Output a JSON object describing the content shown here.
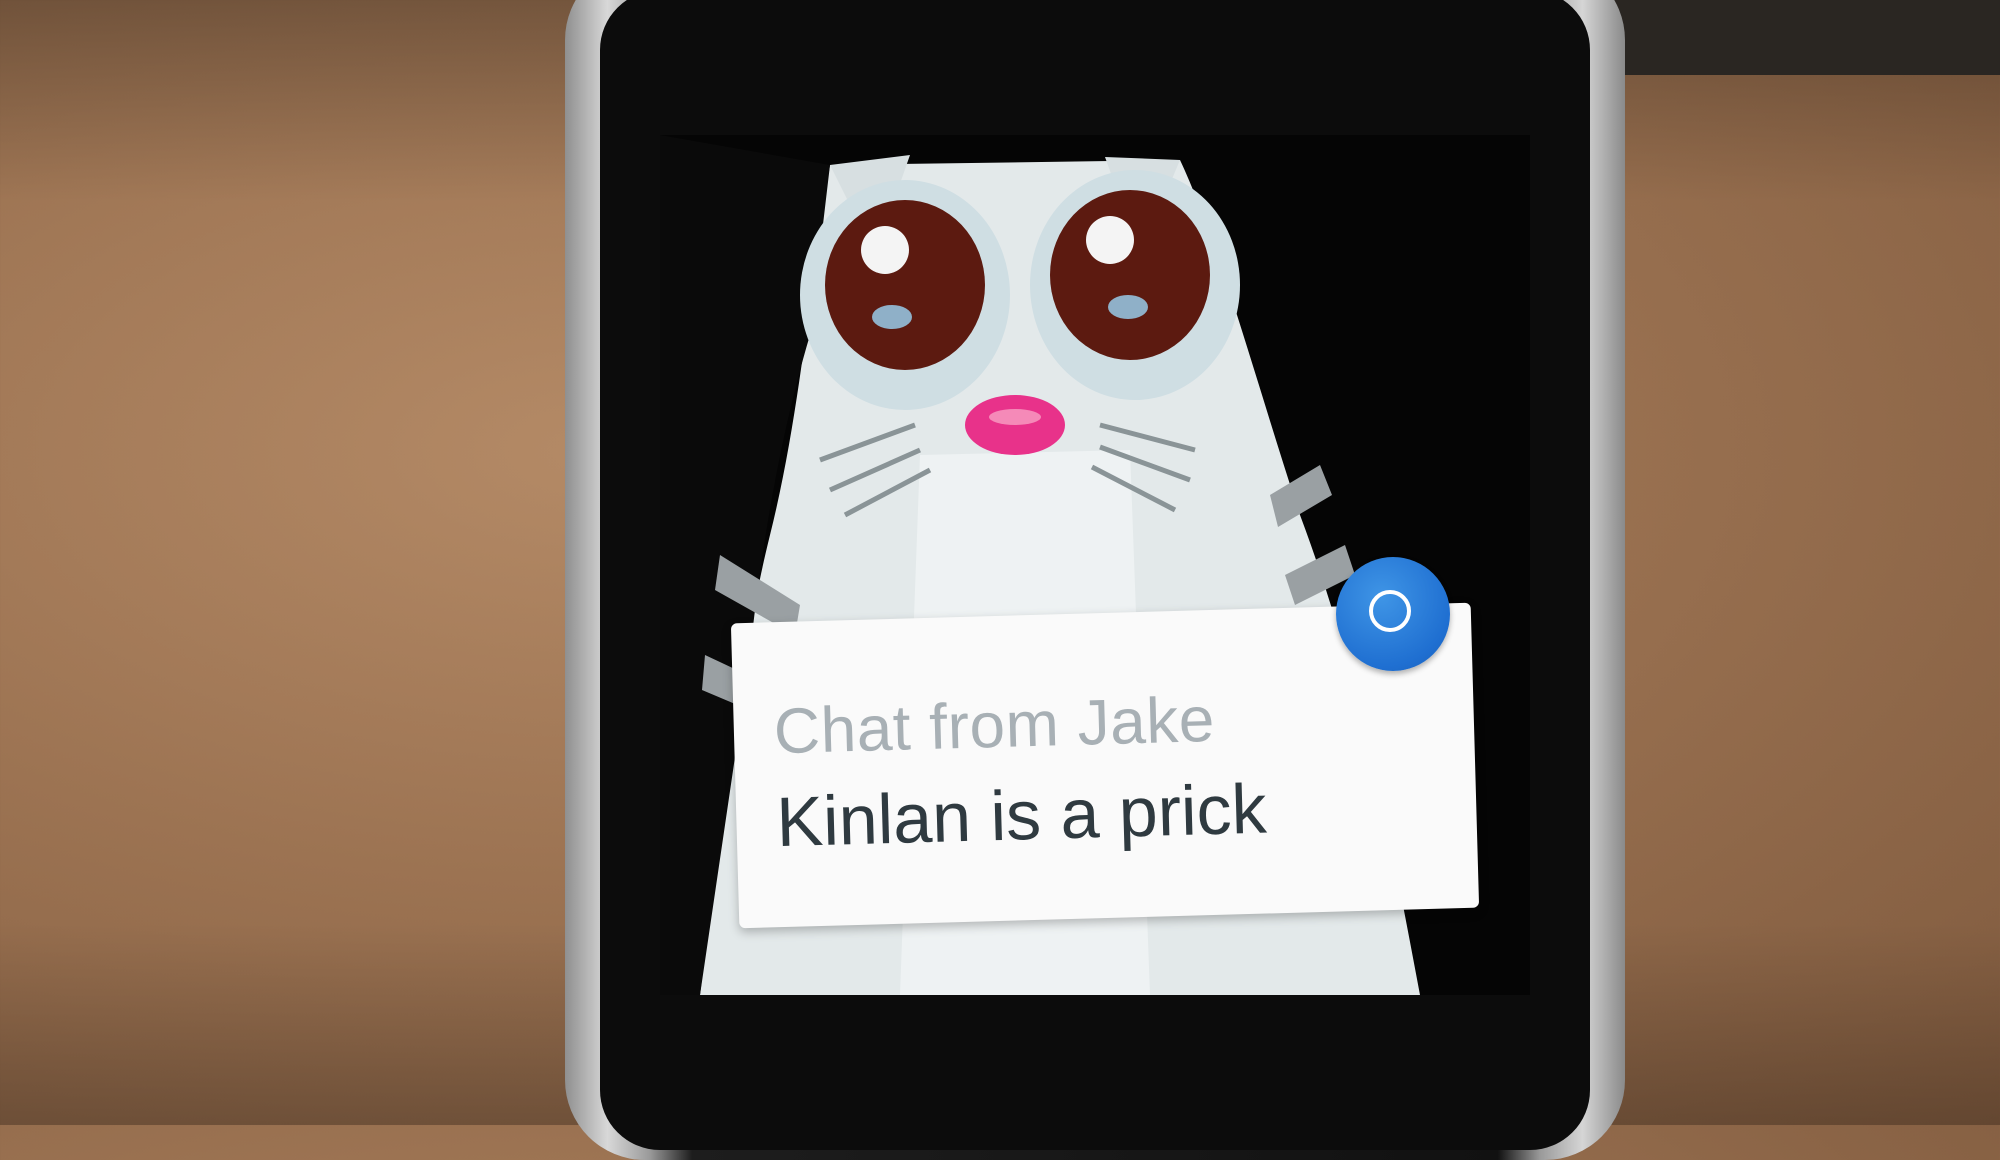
{
  "notification": {
    "title": "Chat from Jake",
    "message": "Kinlan is a prick",
    "app_icon": "chat-app-icon",
    "background_image": "crying-cat-sticker"
  },
  "colors": {
    "card_background": "#fafafa",
    "title_text": "#a8b0b5",
    "message_text": "#2f3a40",
    "app_icon_blue": "#1f6fd1"
  }
}
